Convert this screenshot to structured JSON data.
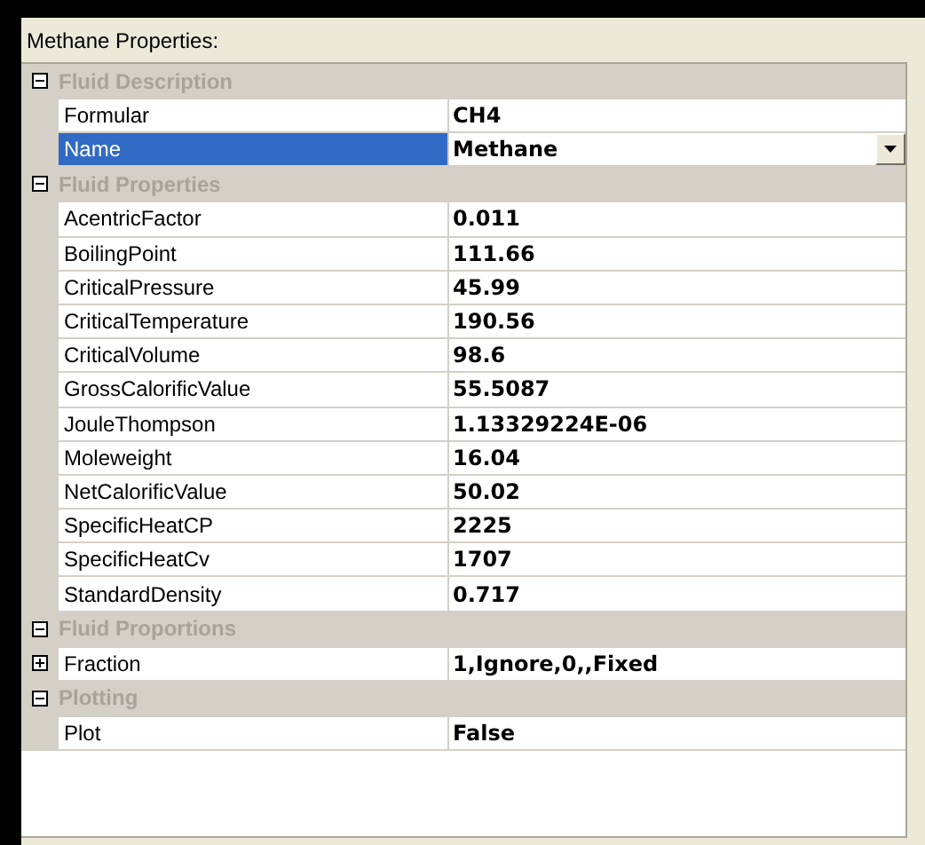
{
  "title": "Methane Properties:",
  "categories": [
    {
      "name": "Fluid Description",
      "expanded": true,
      "properties": [
        {
          "name": "Formular",
          "value": "CH4",
          "selected": false,
          "kind": "text"
        },
        {
          "name": "Name",
          "value": "Methane",
          "selected": true,
          "kind": "dropdown"
        }
      ]
    },
    {
      "name": "Fluid Properties",
      "expanded": true,
      "properties": [
        {
          "name": "AcentricFactor",
          "value": "0.011",
          "selected": false,
          "kind": "text"
        },
        {
          "name": "BoilingPoint",
          "value": "111.66",
          "selected": false,
          "kind": "text"
        },
        {
          "name": "CriticalPressure",
          "value": "45.99",
          "selected": false,
          "kind": "text"
        },
        {
          "name": "CriticalTemperature",
          "value": "190.56",
          "selected": false,
          "kind": "text"
        },
        {
          "name": "CriticalVolume",
          "value": "98.6",
          "selected": false,
          "kind": "text"
        },
        {
          "name": "GrossCalorificValue",
          "value": "55.5087",
          "selected": false,
          "kind": "text"
        },
        {
          "name": "JouleThompson",
          "value": "1.13329224E-06",
          "selected": false,
          "kind": "text"
        },
        {
          "name": "Moleweight",
          "value": "16.04",
          "selected": false,
          "kind": "text"
        },
        {
          "name": "NetCalorificValue",
          "value": "50.02",
          "selected": false,
          "kind": "text"
        },
        {
          "name": "SpecificHeatCP",
          "value": "2225",
          "selected": false,
          "kind": "text"
        },
        {
          "name": "SpecificHeatCv",
          "value": "1707",
          "selected": false,
          "kind": "text"
        },
        {
          "name": "StandardDensity",
          "value": "0.717",
          "selected": false,
          "kind": "text"
        }
      ]
    },
    {
      "name": "Fluid Proportions",
      "expanded": true,
      "properties": [
        {
          "name": "Fraction",
          "value": "1,Ignore,0,,Fixed",
          "selected": false,
          "kind": "expandable",
          "expanded": false
        }
      ]
    },
    {
      "name": "Plotting",
      "expanded": true,
      "properties": [
        {
          "name": "Plot",
          "value": "False",
          "selected": false,
          "kind": "text"
        }
      ]
    }
  ]
}
